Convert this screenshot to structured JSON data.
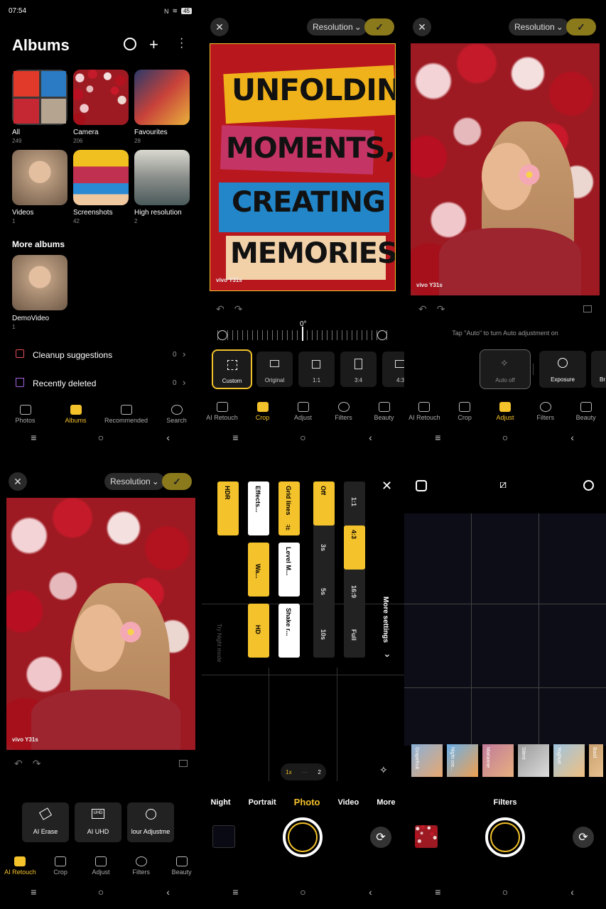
{
  "status_bar": {
    "time": "07:54",
    "battery": "45"
  },
  "albums": {
    "title": "Albums",
    "grid": [
      {
        "name": "All",
        "count": "249"
      },
      {
        "name": "Camera",
        "count": "206"
      },
      {
        "name": "Favourites",
        "count": "28"
      },
      {
        "name": "Videos",
        "count": "1"
      },
      {
        "name": "Screenshots",
        "count": "42"
      },
      {
        "name": "High resolution",
        "count": "2"
      }
    ],
    "more_albums_heading": "More albums",
    "more": [
      {
        "name": "DemoVideo",
        "count": "1"
      }
    ],
    "rows": [
      {
        "label": "Cleanup suggestions",
        "count": "0"
      },
      {
        "label": "Recently deleted",
        "count": "0"
      }
    ],
    "tabs": [
      "Photos",
      "Albums",
      "Recommended",
      "Search"
    ],
    "active_tab": "Albums"
  },
  "editor": {
    "resolution_label": "Resolution",
    "watermark": "vivo Y31s",
    "tabs": [
      "AI Retouch",
      "Crop",
      "Adjust",
      "Filters",
      "Beauty"
    ]
  },
  "crop_screen": {
    "poster_lines": [
      "UNFOLDING",
      "MOMENTS,",
      "CREATING",
      "MEMORIES"
    ],
    "angle": "0°",
    "ratios": [
      "Custom",
      "Original",
      "1:1",
      "3:4",
      "4:3"
    ],
    "active_tab": "Crop"
  },
  "adjust_screen": {
    "hint": "Tap \"Auto\" to turn Auto adjustment on",
    "tools": [
      "Auto off",
      "Exposure",
      "Br"
    ],
    "active_tab": "Adjust"
  },
  "retouch_screen": {
    "tools": [
      "AI Erase",
      "AI UHD",
      "lour Adjustme"
    ],
    "active_tab": "AI Retouch"
  },
  "camera_settings": {
    "toggles": [
      "HDR",
      "Effects...",
      "Grid lines",
      "Wa...",
      "Level M...",
      "HD",
      "Shake r..."
    ],
    "timer": [
      "Off",
      "3s",
      "5s",
      "10s"
    ],
    "ratio": [
      "1:1",
      "4:3",
      "16:9",
      "Full"
    ],
    "more_settings": "More settings",
    "night_hint": "Try Night mode",
    "zoom": [
      "1x",
      "2"
    ],
    "modes": [
      "Night",
      "Portrait",
      "Photo",
      "Video",
      "More"
    ],
    "active_mode": "Photo"
  },
  "camera_filters": {
    "filters": [
      "Grapefruit",
      "Night cre...",
      "Marianne",
      "Silent",
      "Yoghurt",
      "Basil"
    ],
    "label": "Filters"
  },
  "colors": {
    "accent": "#f4c22b",
    "bg": "#000000"
  }
}
